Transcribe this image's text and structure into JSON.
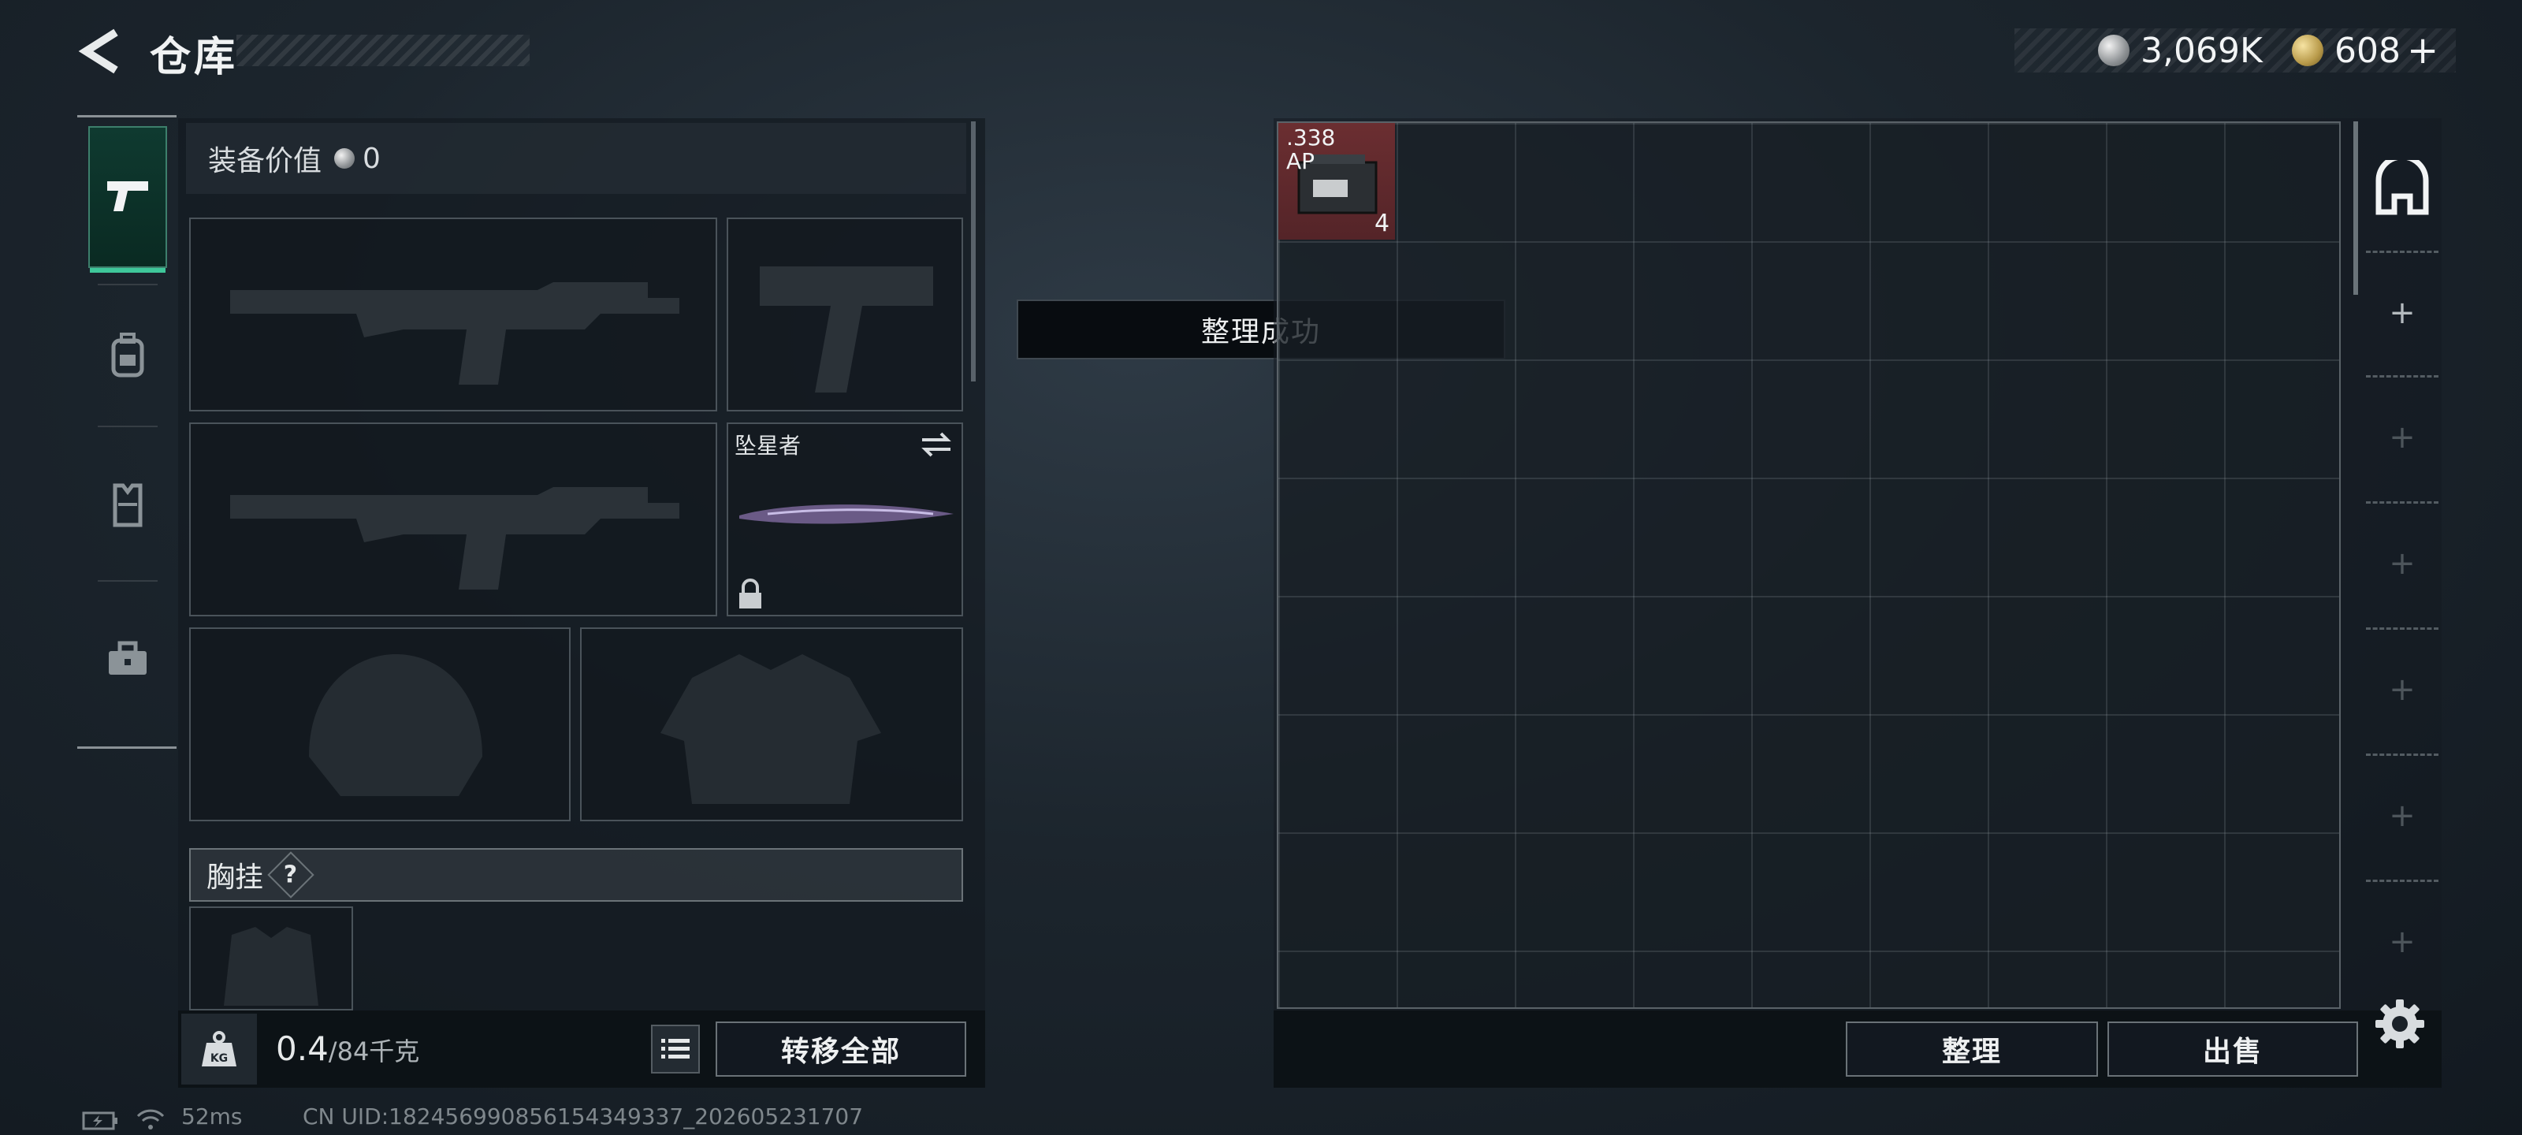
{
  "header": {
    "title": "仓库",
    "currency_silver": "3,069K",
    "currency_gold": "608",
    "add_symbol": "+"
  },
  "tabs": [
    {
      "icon": "pistol-icon",
      "active": true
    },
    {
      "icon": "backpack-icon",
      "active": false
    },
    {
      "icon": "vest-icon",
      "active": false
    },
    {
      "icon": "toolbox-icon",
      "active": false
    }
  ],
  "equipment": {
    "value_label": "装备价值",
    "value": "0",
    "melee_name": "坠星者",
    "chest_rig_label": "胸挂",
    "help_symbol": "?"
  },
  "footer_left": {
    "weight_current": "0.4",
    "weight_max": "/84千克",
    "kg_badge": "KG",
    "transfer_all": "转移全部"
  },
  "toast": {
    "message": "整理成功"
  },
  "storage": {
    "item": {
      "name_line1": ".338",
      "name_line2": "AP",
      "count": "4"
    },
    "add_slot_symbol": "+",
    "organize": "整理",
    "sell": "出售"
  },
  "status_bar": {
    "ping": "52ms",
    "uid": "CN UID:182456990856154349337_202605231707"
  },
  "colors": {
    "active_tab_green": "#3fc79a",
    "item_background": "#6b2e31"
  }
}
